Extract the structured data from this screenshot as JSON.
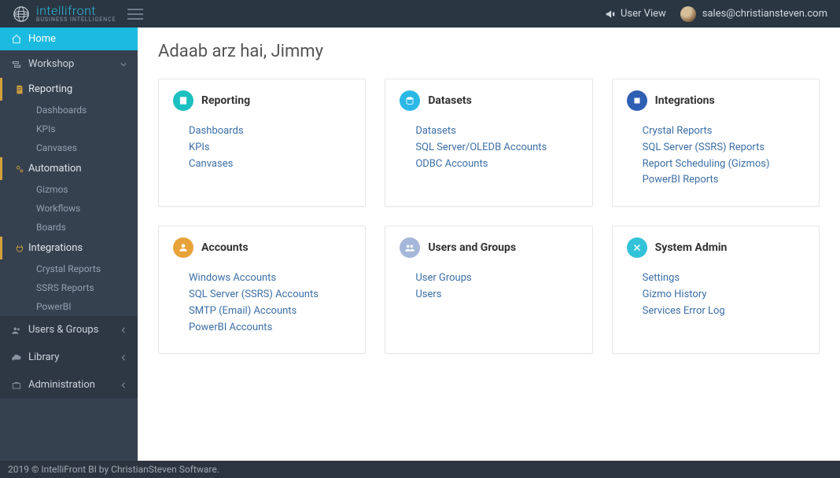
{
  "topbar": {
    "brand_name": "intellifront",
    "brand_sub": "BUSINESS INTELLIGENCE",
    "user_view": "User View",
    "account_email": "sales@christiansteven.com"
  },
  "sidebar": {
    "home": "Home",
    "workshop": "Workshop",
    "reporting": {
      "label": "Reporting",
      "items": [
        "Dashboards",
        "KPIs",
        "Canvases"
      ]
    },
    "automation": {
      "label": "Automation",
      "items": [
        "Gizmos",
        "Workflows",
        "Boards"
      ]
    },
    "integrations": {
      "label": "Integrations",
      "items": [
        "Crystal Reports",
        "SSRS Reports",
        "PowerBI"
      ]
    },
    "users_groups": "Users & Groups",
    "library": "Library",
    "administration": "Administration"
  },
  "main": {
    "greeting": "Adaab arz hai, Jimmy",
    "cards": {
      "reporting": {
        "title": "Reporting",
        "color": "#1cc0c0",
        "links": [
          "Dashboards",
          "KPIs",
          "Canvases"
        ]
      },
      "datasets": {
        "title": "Datasets",
        "color": "#2bb8e6",
        "links": [
          "Datasets",
          "SQL Server/OLEDB Accounts",
          "ODBC Accounts"
        ]
      },
      "integrations": {
        "title": "Integrations",
        "color": "#2e5fb3",
        "links": [
          "Crystal Reports",
          "SQL Server (SSRS) Reports",
          "Report Scheduling (Gizmos)",
          "PowerBI Reports"
        ]
      },
      "accounts": {
        "title": "Accounts",
        "color": "#e8a23a",
        "links": [
          "Windows Accounts",
          "SQL Server (SSRS) Accounts",
          "SMTP (Email) Accounts",
          "PowerBI Accounts"
        ]
      },
      "users_groups": {
        "title": "Users and Groups",
        "color": "#a6b8d9",
        "links": [
          "User Groups",
          "Users"
        ]
      },
      "system_admin": {
        "title": "System Admin",
        "color": "#32c3d9",
        "links": [
          "Settings",
          "Gizmo History",
          "Services Error Log"
        ]
      }
    }
  },
  "footer": {
    "text": "2019 © IntelliFront BI by ChristianSteven Software."
  }
}
